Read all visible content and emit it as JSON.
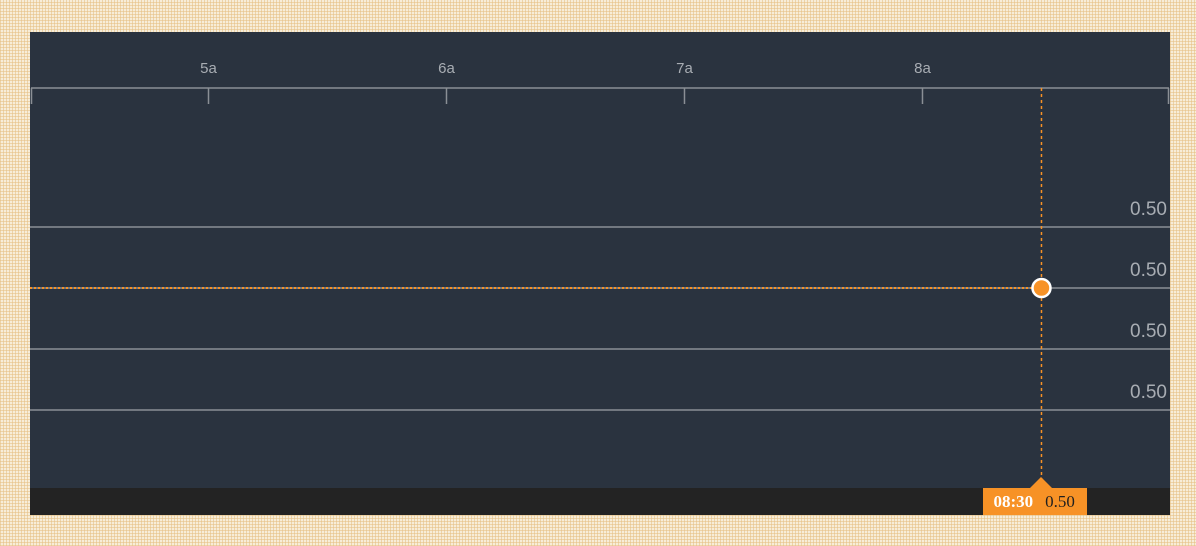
{
  "chart_data": {
    "type": "line",
    "title": "",
    "xlabel": "",
    "ylabel": "",
    "x_ticks": [
      "5a",
      "6a",
      "7a",
      "8a"
    ],
    "x_tick_hours": [
      5,
      6,
      7,
      8
    ],
    "xlim": [
      4.25,
      9.04
    ],
    "y_tick_labels": [
      "0.50",
      "0.50",
      "0.50",
      "0.50"
    ],
    "series": [
      {
        "x": [
          "08:30"
        ],
        "values": [
          0.5
        ]
      }
    ],
    "crosshair": {
      "time": "08:30",
      "value": "0.50"
    },
    "colors": {
      "background": "#2a333f",
      "footer": "#232323",
      "accent": "#f79226",
      "grid": "#8a8f95",
      "text": "#a8adb3"
    },
    "grid": true,
    "legend": "none"
  }
}
